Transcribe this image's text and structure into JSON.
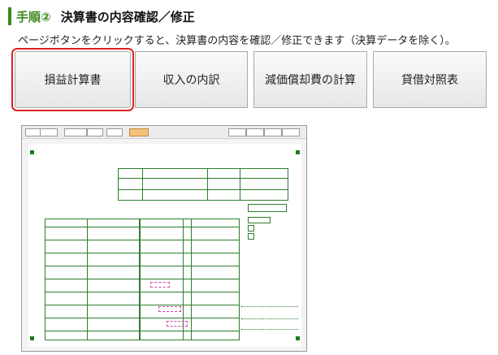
{
  "header": {
    "step_label": "手順②",
    "title": "決算書の内容確認／修正"
  },
  "instruction": "ページボタンをクリックすると、決算書の内容を確認／修正できます（決算データを除く）。",
  "buttons": [
    {
      "label": "損益計算書",
      "selected": true
    },
    {
      "label": "収入の内訳",
      "selected": false
    },
    {
      "label": "減価償却費の計算",
      "selected": false
    },
    {
      "label": "貸借対照表",
      "selected": false
    }
  ],
  "colors": {
    "accent_green": "#3a8a1c",
    "selection_red": "#e02020",
    "form_green": "#2d7d2d"
  }
}
